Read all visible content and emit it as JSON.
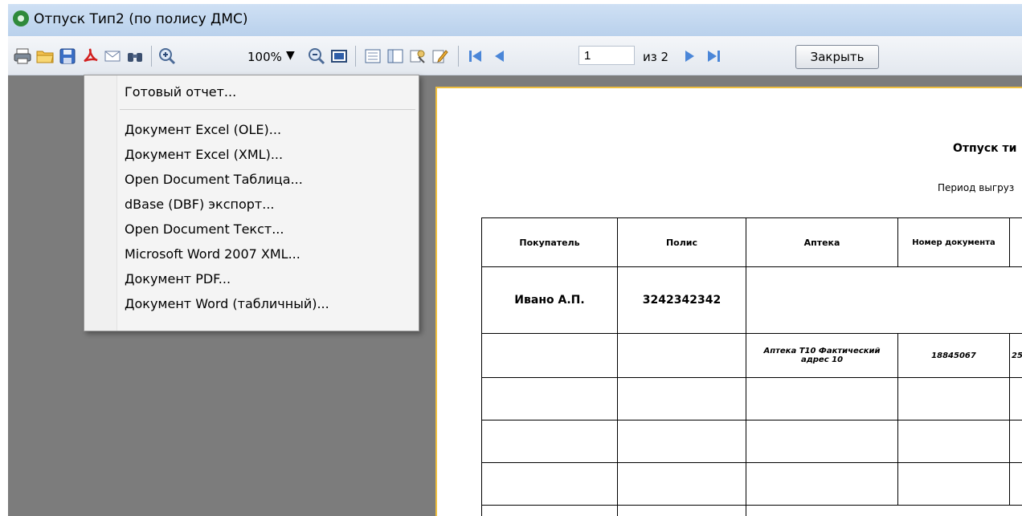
{
  "window": {
    "title": "Отпуск Тип2 (по полису ДМС)"
  },
  "toolbar": {
    "zoom": "100%",
    "page_current": "1",
    "page_of": "из 2",
    "close_label": "Закрыть",
    "icons": [
      "print-icon",
      "open-icon",
      "save-icon",
      "pdf-icon",
      "email-icon",
      "find-icon",
      "zoom-in-icon",
      "zoom-out-icon",
      "fullpage-icon",
      "outline-icon",
      "thumbnails-icon",
      "design-icon",
      "edit-icon",
      "first-page-icon",
      "prev-page-icon",
      "next-page-icon",
      "last-page-icon"
    ]
  },
  "export_menu": {
    "items": [
      "Готовый отчет...",
      "Документ Excel (OLE)...",
      "Документ Excel (XML)...",
      "Open Document Таблица...",
      "dBase (DBF) экспорт...",
      "Open Document Текст...",
      "Microsoft Word 2007 XML...",
      "Документ PDF...",
      "Документ Word (табличный)..."
    ]
  },
  "report": {
    "title": "Отпуск ти",
    "period": "Период выгруз",
    "columns": [
      "Покупатель",
      "Полис",
      "Аптека",
      "Номер документа"
    ],
    "group_row": {
      "buyer": "Ивано А.П.",
      "policy": "3242342342"
    },
    "detail_row": {
      "pharmacy": "Аптека Т10 Фактический адрес 10",
      "doc_number": "18845067",
      "extra": "25"
    }
  }
}
